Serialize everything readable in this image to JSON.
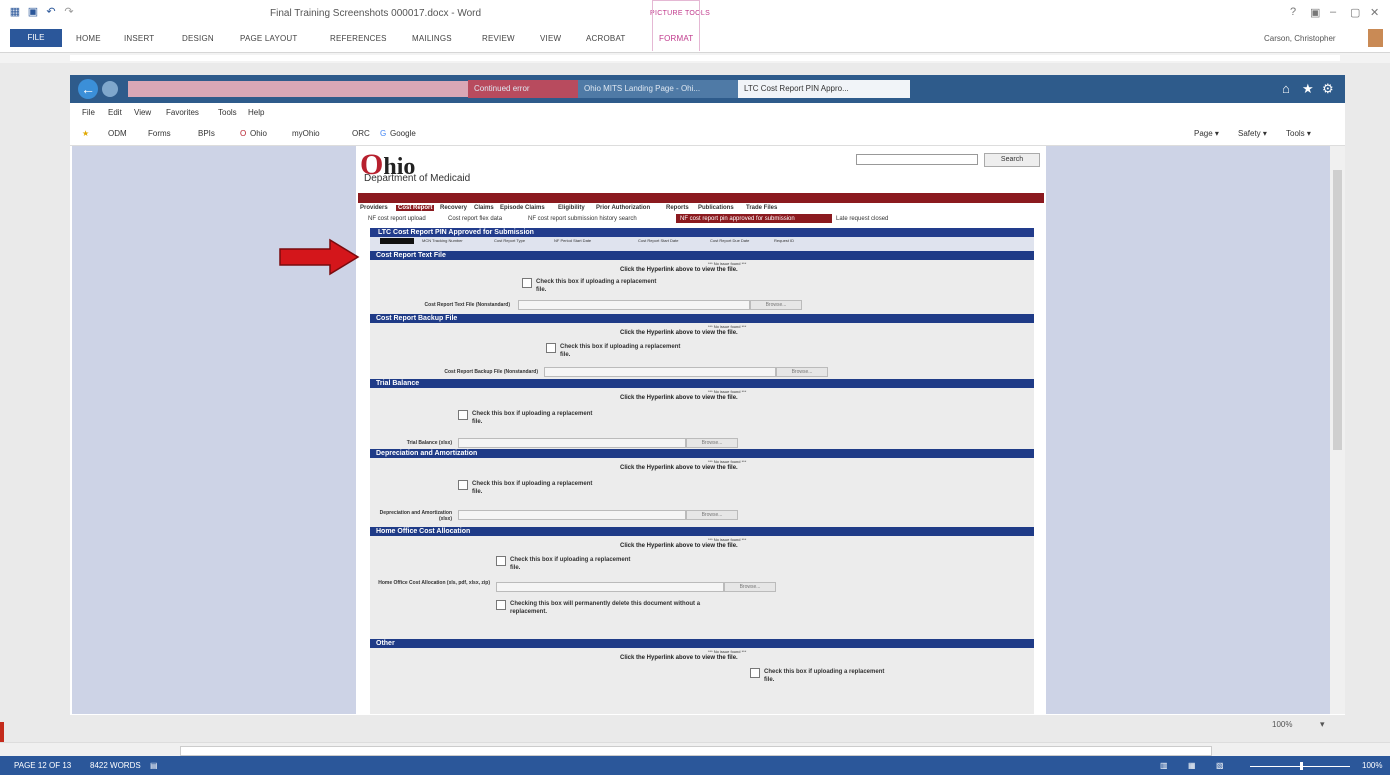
{
  "word": {
    "doc_title": "Final Training Screenshots 000017.docx - Word",
    "context_tab_title": "PICTURE TOOLS",
    "tabs": [
      "FILE",
      "HOME",
      "INSERT",
      "DESIGN",
      "PAGE LAYOUT",
      "REFERENCES",
      "MAILINGS",
      "REVIEW",
      "VIEW",
      "ACROBAT",
      "FORMAT"
    ],
    "user": "Carson, Christopher",
    "window_buttons": [
      "?",
      "▣",
      "–",
      "▢",
      "✕"
    ],
    "status": {
      "page": "PAGE 12 OF 13",
      "words": "8422 WORDS",
      "zoom": "100%",
      "zoom_right": "100%"
    }
  },
  "ie": {
    "tabs": [
      "Continued error",
      "Ohio MITS Landing Page - Ohi...",
      "LTC Cost Report PIN Appro..."
    ],
    "menu": [
      "File",
      "Edit",
      "View",
      "Favorites",
      "Tools",
      "Help"
    ],
    "favorites": [
      "ODM",
      "Forms",
      "BPIs",
      "Ohio",
      "myOhio",
      "ORC",
      "Google"
    ],
    "toolbar_right": [
      "Page ▾",
      "Safety ▾",
      "Tools ▾"
    ]
  },
  "ohio": {
    "logo_o": "O",
    "logo_rest": "hio",
    "dept": "Department of Medicaid",
    "search_label": "Search",
    "nav": [
      "Providers",
      "Cost Report",
      "Recovery",
      "Claims",
      "Episode Claims",
      "Eligibility",
      "Prior Authorization",
      "Reports",
      "Publications",
      "Trade Files"
    ],
    "nav_active": "Cost Report",
    "subnav": [
      "NF cost report upload",
      "Cost report flex data",
      "NF cost report submission history search",
      "NF cost report pin approved for submission",
      "Late request closed"
    ],
    "panel_title": "LTC Cost Report PIN Approved for Submission",
    "col_headers": [
      "Provider",
      "MCN Tracking Number",
      "Cost Report Type",
      "NF Period Start Date",
      "Cost Report Start Date",
      "Cost Report Due Date",
      "Request ID"
    ],
    "sections": [
      {
        "title": "Cost Report Text File",
        "note": "*** No issue found ***",
        "hint": "Click the Hyperlink above to view the file.",
        "check": "Check this box if uploading a replacement file.",
        "field": "Cost Report Text File (Nonstandard)",
        "browse": "Browse..."
      },
      {
        "title": "Cost Report Backup File",
        "note": "*** No issue found ***",
        "hint": "Click the Hyperlink above to view the file.",
        "check": "Check this box if uploading a replacement file.",
        "field": "Cost Report Backup File (Nonstandard)",
        "browse": "Browse..."
      },
      {
        "title": "Trial Balance",
        "note": "*** No issue found ***",
        "hint": "Click the Hyperlink above to view the file.",
        "check": "Check this box if uploading a replacement file.",
        "field": "Trial Balance (xlsx)",
        "browse": "Browse..."
      },
      {
        "title": "Depreciation and Amortization",
        "note": "*** No issue found ***",
        "hint": "Click the Hyperlink above to view the file.",
        "check": "Check this box if uploading a replacement file.",
        "field": "Depreciation and Amortization (xlsx)",
        "browse": "Browse..."
      },
      {
        "title": "Home Office Cost Allocation",
        "note": "*** No issue found ***",
        "hint": "Click the Hyperlink above to view the file.",
        "check": "Check this box if uploading a replacement file.",
        "field": "Home Office Cost Allocation (xls, pdf, xlsx, zip)",
        "browse": "Browse...",
        "check2": "Checking this box will permanently delete this document without a replacement."
      },
      {
        "title": "Other",
        "note": "*** No issue found ***",
        "hint": "Click the Hyperlink above to view the file.",
        "check": "Check this box if uploading a replacement file."
      }
    ]
  },
  "colors": {
    "word_blue": "#2b579a",
    "ohio_red": "#8b1a1f",
    "section_blue": "#1f3b87",
    "arrow_red": "#d4161b"
  }
}
